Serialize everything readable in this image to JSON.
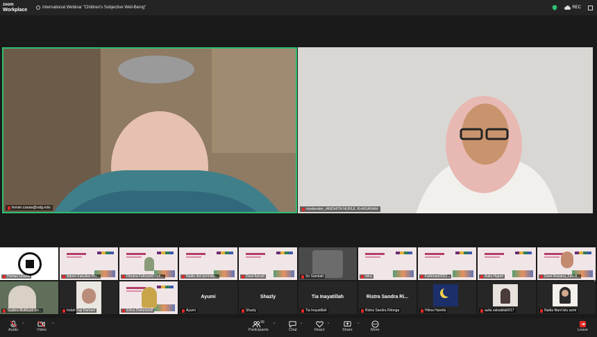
{
  "app": {
    "logo_line1": "zoom",
    "logo_line2": "Workplace",
    "meeting_title": "International Webinar \"Children's Subjective Well-Being\"",
    "rec_label": "REC"
  },
  "main_tiles": [
    {
      "name": "ferran.casas@udg.edu"
    },
    {
      "name": "moderator_ANDHITA NURUL KHASANAH"
    }
  ],
  "strip_row1": [
    {
      "name": "Humas Unisba"
    },
    {
      "name": "Admin Fakultas Psi..."
    },
    {
      "name": "Fitriana Fabryanti Rah..."
    },
    {
      "name": "Nadia dwi permata..."
    },
    {
      "name": "Dewi Azizah"
    },
    {
      "name": "Sri Sumirah"
    },
    {
      "name": "mira"
    },
    {
      "name": "Farhmani2022..."
    },
    {
      "name": "Aulia Hajrah"
    },
    {
      "name": "Dewi Rosiana_Fakult..."
    }
  ],
  "strip_row2": [
    {
      "name": "Syakira Muthiyah Izz..."
    },
    {
      "name": "Indah Fajr Ramani"
    },
    {
      "name": "Erlisa Dwiarawati"
    },
    {
      "name": "Ayumi",
      "big": "Ayumi"
    },
    {
      "name": "Shazly",
      "big": "Shazly"
    },
    {
      "name": "Tia Inayatillah",
      "big": "Tia Inayatillah"
    },
    {
      "name": "Ristra Sandra Ritonga",
      "big": "Ristra Sandra Ri..."
    },
    {
      "name": "Hilma Hanefa"
    },
    {
      "name": "aulia salsabila0017"
    },
    {
      "name": "Nadia fitani lulu azmi"
    }
  ],
  "toolbar": {
    "audio": "Audio",
    "video": "Video",
    "participants": "Participants",
    "participants_count": "99",
    "chat": "Chat",
    "react": "React",
    "share": "Share",
    "more": "More",
    "leave": "Leave"
  },
  "colors": {
    "active_speaker": "#2fbf71",
    "muted": "#e02828",
    "leave": "#e02828"
  }
}
